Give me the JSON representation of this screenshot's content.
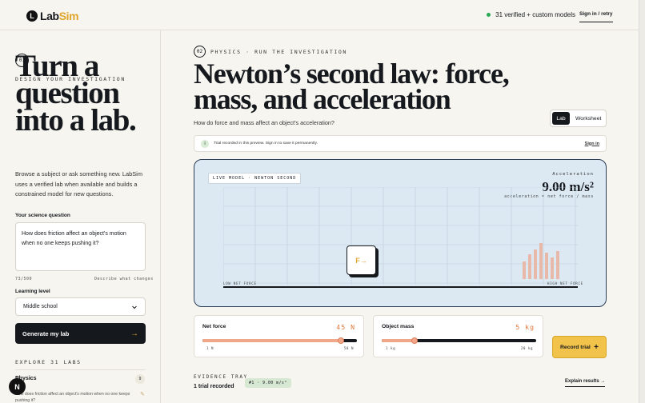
{
  "header": {
    "logo_mark": "L",
    "logo_lab": "Lab",
    "logo_sim": "Sim",
    "models_text": "31 verified + custom models",
    "signin": "Sign in / retry"
  },
  "left": {
    "step": "01",
    "eyebrow": "Design your investigation",
    "headline": "Turn a question into a lab.",
    "description": "Browse a subject or ask something new. LabSim uses a verified lab when available and builds a constrained model for new questions.",
    "question_label": "Your science question",
    "question_value": "How does friction affect an object's motion when no one keeps pushing it?",
    "char_count": "73/500",
    "describe_hint": "Describe what changes",
    "level_label": "Learning level",
    "level_value": "Middle school",
    "generate_label": "Generate my lab",
    "explore_label": "Explore 31 labs",
    "lab_item_title": "Physics",
    "lab_item_count": "9",
    "lab_item_desc": "How does friction affect an object's motion when no one keeps pushing it?",
    "fab_letter": "N"
  },
  "right": {
    "step": "02",
    "breadcrumb": "Physics · Run the investigation",
    "title": "Newton’s second law: force, mass, and acceleration",
    "question": "How do force and mass affect an object's acceleration?",
    "tab_lab": "Lab",
    "tab_worksheet": "Worksheet",
    "notice_icon": "i",
    "notice": "Trial recorded in this preview. Sign in to save it permanently.",
    "notice_signin": "Sign in",
    "live_label": "Live model · Newton second",
    "acc_label": "Acceleration",
    "acc_value": "9.00 m/s²",
    "acc_formula": "acceleration = net force / mass",
    "axis_low": "Low net force",
    "axis_high": "High net force",
    "block_label": "F→",
    "force": {
      "name": "Net force",
      "value": "45 N",
      "min": "1 N",
      "max": "50 N",
      "level": 0.898
    },
    "mass": {
      "name": "Object mass",
      "value": "5 kg",
      "min": "1 kg",
      "max": "20 kg",
      "level": 0.21
    },
    "record_label": "Record trial",
    "record_icon": "+",
    "evidence_label": "Evidence tray",
    "trials_recorded": "1 trial recorded",
    "trial_chip": "#1 · 9.00 m/s²",
    "explain_label": "Explain results →"
  },
  "colors": {
    "accent": "#e0a52a",
    "status_green": "#2aa854",
    "lab_bg": "#dce9f3",
    "slider": "#f0a78a"
  },
  "icons": {
    "logo": "logo-icon",
    "status": "status-dot-icon",
    "chevron": "chevron-down-icon",
    "arrow": "arrow-right-icon",
    "info": "info-icon",
    "plus": "plus-icon",
    "pencil": "pencil-icon"
  }
}
